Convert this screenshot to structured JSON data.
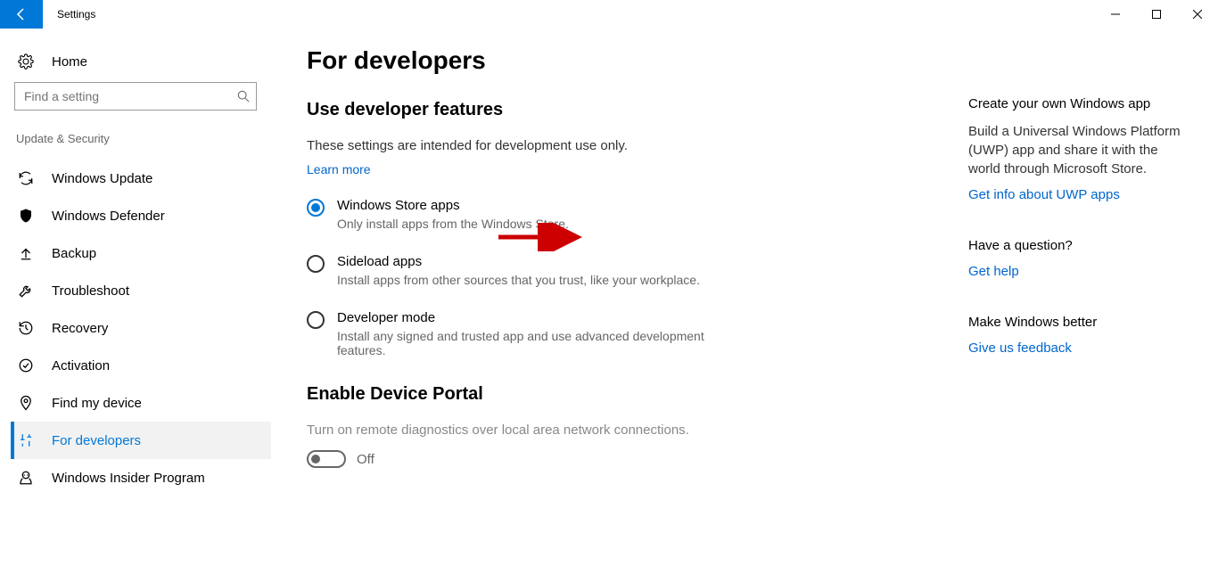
{
  "window": {
    "title": "Settings"
  },
  "sidebar": {
    "home": "Home",
    "search_placeholder": "Find a setting",
    "group": "Update & Security",
    "items": [
      {
        "label": "Windows Update"
      },
      {
        "label": "Windows Defender"
      },
      {
        "label": "Backup"
      },
      {
        "label": "Troubleshoot"
      },
      {
        "label": "Recovery"
      },
      {
        "label": "Activation"
      },
      {
        "label": "Find my device"
      },
      {
        "label": "For developers"
      },
      {
        "label": "Windows Insider Program"
      }
    ]
  },
  "main": {
    "title": "For developers",
    "dev_features_header": "Use developer features",
    "dev_features_text": "These settings are intended for development use only.",
    "learn_more": "Learn more",
    "radios": [
      {
        "label": "Windows Store apps",
        "desc": "Only install apps from the Windows Store."
      },
      {
        "label": "Sideload apps",
        "desc": "Install apps from other sources that you trust, like your workplace."
      },
      {
        "label": "Developer mode",
        "desc": "Install any signed and trusted app and use advanced development features."
      }
    ],
    "portal_header": "Enable Device Portal",
    "portal_text": "Turn on remote diagnostics over local area network connections.",
    "toggle_label": "Off"
  },
  "info": {
    "create_title": "Create your own Windows app",
    "create_text": "Build a Universal Windows Platform (UWP) app and share it with the world through Microsoft Store.",
    "create_link": "Get info about UWP apps",
    "question_title": "Have a question?",
    "question_link": "Get help",
    "better_title": "Make Windows better",
    "better_link": "Give us feedback"
  }
}
